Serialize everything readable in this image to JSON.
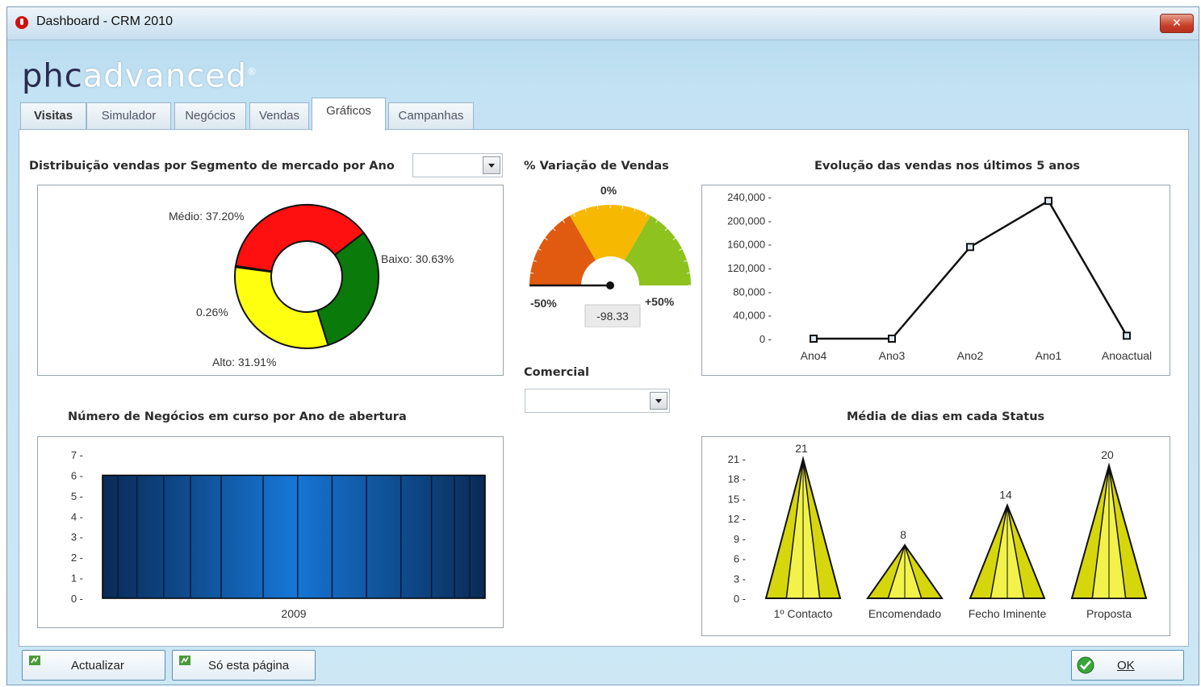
{
  "window": {
    "title": "Dashboard - CRM 2010",
    "close_label": "✕"
  },
  "logo": {
    "part1": "phc",
    "part2": "advanced",
    "reg": "®"
  },
  "tabs": [
    {
      "label": "Visitas"
    },
    {
      "label": "Simulador"
    },
    {
      "label": "Negócios"
    },
    {
      "label": "Vendas"
    },
    {
      "label": "Gráficos"
    },
    {
      "label": "Campanhas"
    }
  ],
  "segment_chart": {
    "title": "Distribuição vendas por Segmento de mercado por Ano",
    "year_selected": "",
    "chart_data": {
      "type": "pie",
      "slices": [
        {
          "label": "Médio: 37.20%",
          "value": 37.2,
          "color": "#ff1010"
        },
        {
          "label": "Baixo: 30.63%",
          "value": 30.63,
          "color": "#0a7a0a"
        },
        {
          "label": "Alto: 31.91%",
          "value": 31.91,
          "color": "#ffff10"
        },
        {
          "label": "0.26%",
          "value": 0.26,
          "color": "#ffffff"
        }
      ]
    }
  },
  "gauge": {
    "title": "% Variação de Vendas",
    "top_label": "0%",
    "min_label": "-50%",
    "max_label": "+50%",
    "value_label": "-98.33",
    "value": -98.33,
    "colors": [
      "#e05a10",
      "#f6b800",
      "#8ec21e"
    ]
  },
  "comercial": {
    "label": "Comercial",
    "value": ""
  },
  "evolution_chart": {
    "title": "Evolução das vendas nos últimos 5 anos",
    "chart_data": {
      "type": "line",
      "categories": [
        "Ano4",
        "Ano3",
        "Ano2",
        "Ano1",
        "Anoactual"
      ],
      "values": [
        0,
        0,
        155000,
        233000,
        5000
      ],
      "yticks": [
        "240,000",
        "200,000",
        "160,000",
        "120,000",
        "80,000",
        "40,000",
        "0"
      ],
      "ylim": [
        0,
        240000
      ]
    }
  },
  "negocios_chart": {
    "title": "Número de Negócios em curso por Ano de abertura",
    "chart_data": {
      "type": "bar",
      "categories": [
        "2009"
      ],
      "values": [
        6
      ],
      "yticks": [
        "7",
        "6",
        "5",
        "4",
        "3",
        "2",
        "1",
        "0"
      ],
      "ylim": [
        0,
        7
      ],
      "color": "#1565c0"
    }
  },
  "status_chart": {
    "title": "Média de dias em cada Status",
    "chart_data": {
      "type": "bar",
      "categories": [
        "1º Contacto",
        "Encomendado",
        "Fecho Iminente",
        "Proposta"
      ],
      "values": [
        21,
        8,
        14,
        20
      ],
      "data_labels": [
        "21",
        "8",
        "14",
        "20"
      ],
      "yticks": [
        "21",
        "18",
        "15",
        "12",
        "9",
        "6",
        "3",
        "0"
      ],
      "ylim": [
        0,
        21
      ],
      "color": "#d6d60c"
    }
  },
  "footer": {
    "refresh_label": "Actualizar",
    "this_page_label": "Só esta página",
    "ok_label": "OK"
  }
}
